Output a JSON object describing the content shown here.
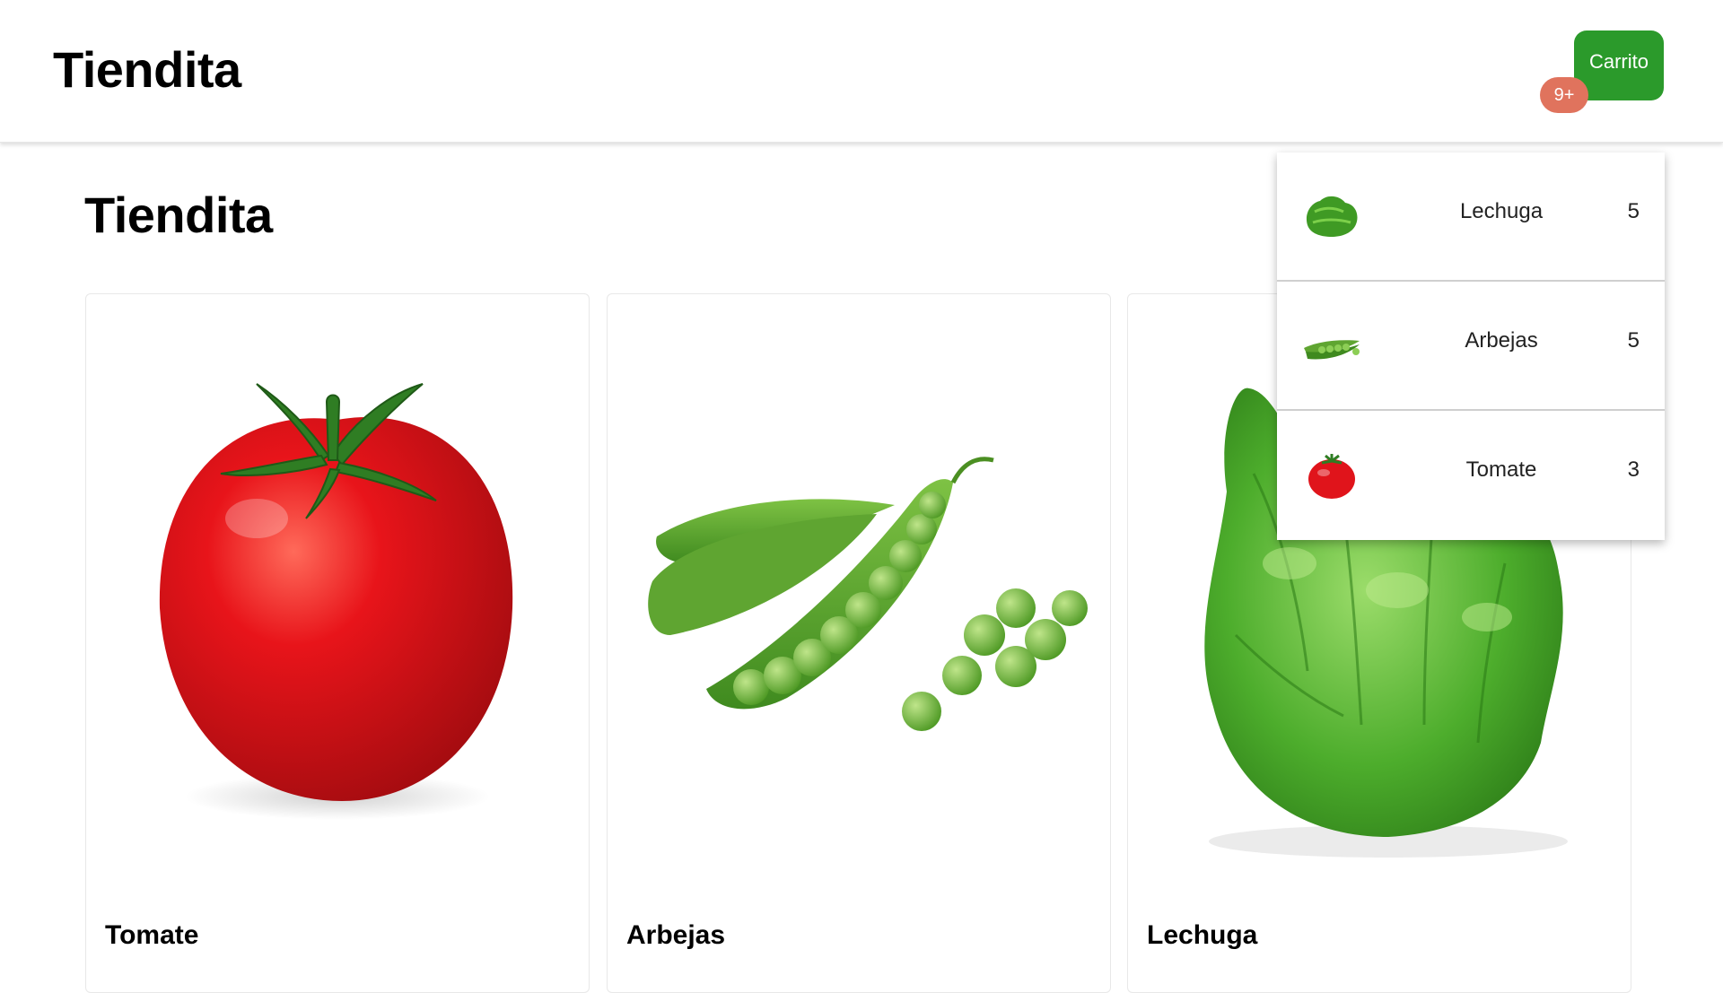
{
  "navbar": {
    "brand": "Tiendita",
    "cart_button_label": "Carrito",
    "cart_badge": "9+"
  },
  "main": {
    "title": "Tiendita",
    "products": [
      {
        "name": "Tomate",
        "image_icon": "tomato-image"
      },
      {
        "name": "Arbejas",
        "image_icon": "peas-image"
      },
      {
        "name": "Lechuga",
        "image_icon": "lettuce-image"
      }
    ]
  },
  "cart": {
    "items": [
      {
        "name": "Lechuga",
        "qty": "5",
        "thumb_icon": "lettuce-thumb"
      },
      {
        "name": "Arbejas",
        "qty": "5",
        "thumb_icon": "peas-thumb"
      },
      {
        "name": "Tomate",
        "qty": "3",
        "thumb_icon": "tomato-thumb"
      }
    ]
  },
  "colors": {
    "cart_button": "#2b9a2b",
    "badge": "#e0735d",
    "tomato": "#e0141b",
    "leaf_green": "#3fae2a",
    "pea_green": "#6ab33a"
  }
}
